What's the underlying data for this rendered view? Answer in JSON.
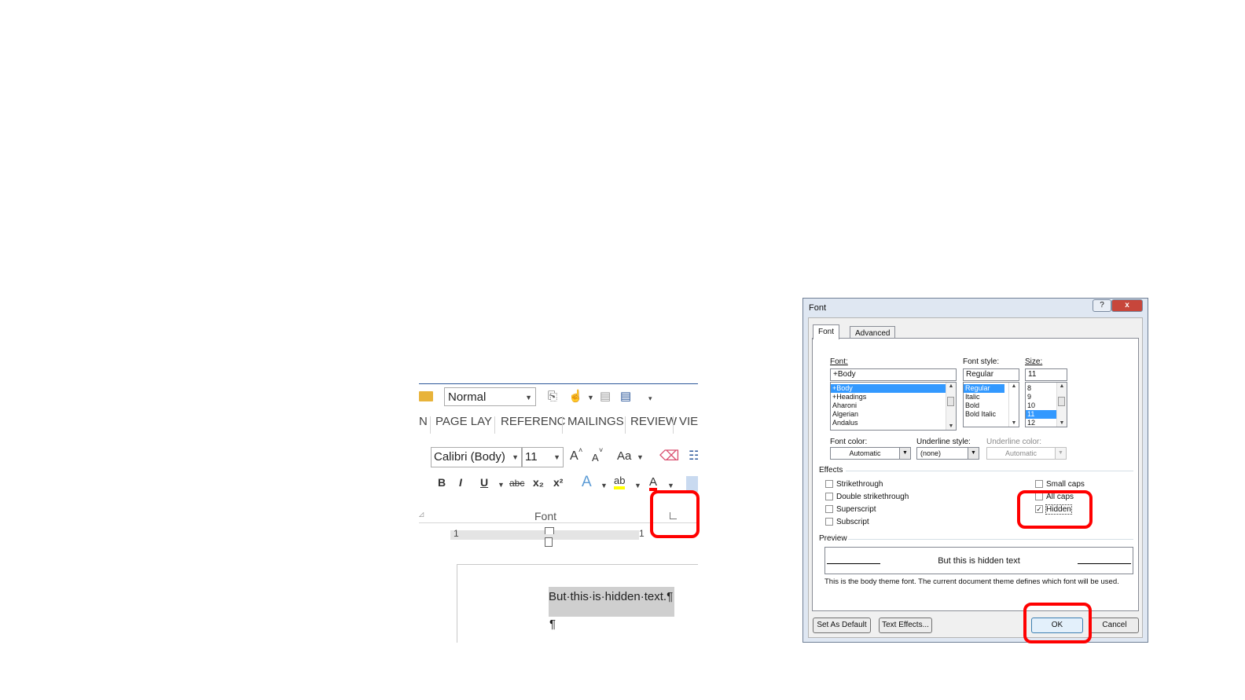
{
  "ribbon": {
    "style_value": "Normal",
    "tabs": [
      "N",
      "PAGE LAY",
      "REFERENC",
      "MAILINGS",
      "REVIEW",
      "VIEW"
    ],
    "font_name": "Calibri (Body)",
    "font_size": "11",
    "grow_font": "A",
    "shrink_font": "A",
    "change_case": "Aa",
    "bold": "B",
    "italic": "I",
    "underline": "U",
    "strikethrough": "abc",
    "subscript": "x₂",
    "superscript": "x²",
    "text_effects": "A",
    "highlight": "ab",
    "font_color": "A",
    "group_label": "Font",
    "ruler_left": "1",
    "ruler_right": "1",
    "doc_line1": "But·this·is·hidden·text.",
    "pilcrow": "¶",
    "doc_line2": "¶"
  },
  "dialog": {
    "title": "Font",
    "help_btn": "?",
    "close_btn": "x",
    "tabs": [
      "Font",
      "Advanced"
    ],
    "font_label": "Font:",
    "font_value": "+Body",
    "font_list": [
      "+Body",
      "+Headings",
      "Aharoni",
      "Algerian",
      "Andalus"
    ],
    "style_label": "Font style:",
    "style_value": "Regular",
    "style_list": [
      "Regular",
      "Italic",
      "Bold",
      "Bold Italic"
    ],
    "size_label": "Size:",
    "size_value": "11",
    "size_list": [
      "8",
      "9",
      "10",
      "11",
      "12"
    ],
    "font_color_label": "Font color:",
    "font_color_value": "Automatic",
    "underline_style_label": "Underline style:",
    "underline_style_value": "(none)",
    "underline_color_label": "Underline color:",
    "underline_color_value": "Automatic",
    "effects_label": "Effects",
    "effects_left": [
      {
        "label": "Strikethrough",
        "checked": false
      },
      {
        "label": "Double strikethrough",
        "checked": false
      },
      {
        "label": "Superscript",
        "checked": false
      },
      {
        "label": "Subscript",
        "checked": false
      }
    ],
    "effects_right": [
      {
        "label": "Small caps",
        "checked": false
      },
      {
        "label": "All caps",
        "checked": false
      },
      {
        "label": "Hidden",
        "checked": true
      }
    ],
    "preview_label": "Preview",
    "preview_text": "But this is hidden text",
    "preview_note": "This is the body theme font. The current document theme defines which font will be used.",
    "buttons": {
      "set_default": "Set As Default",
      "text_effects": "Text Effects...",
      "ok": "OK",
      "cancel": "Cancel"
    }
  },
  "colors": {
    "highlight_red": "#ff0000",
    "selection_blue": "#3399ff",
    "word_blue": "#2b579a"
  }
}
